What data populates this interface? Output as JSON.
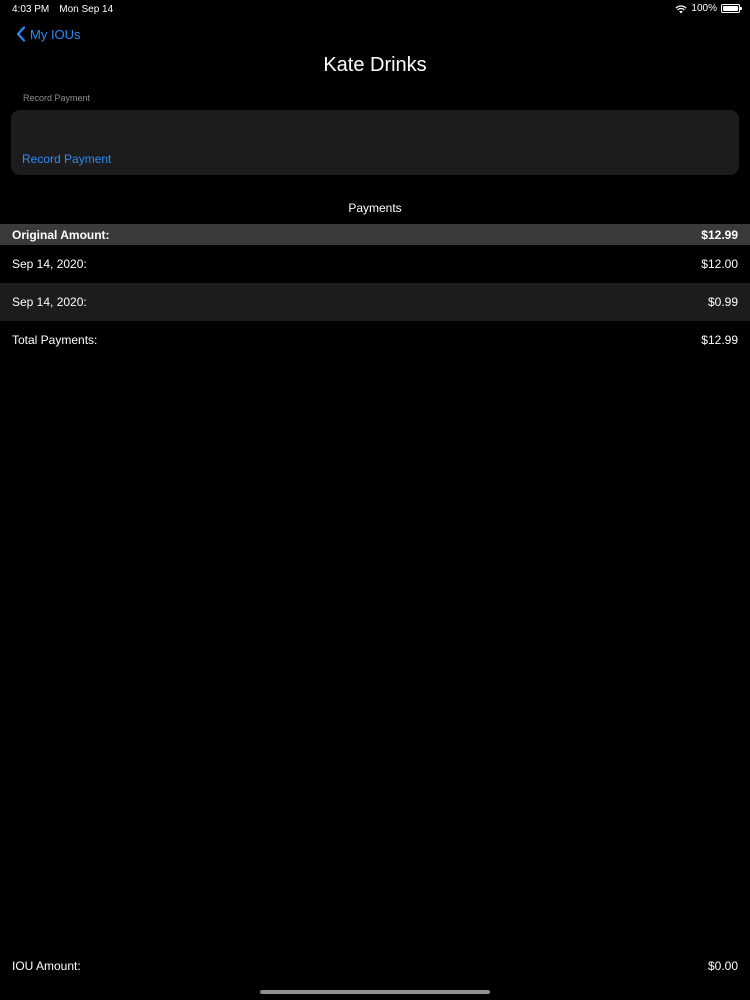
{
  "status_bar": {
    "time": "4:03 PM",
    "date": "Mon Sep 14",
    "battery": "100%",
    "battery_level": 1.0
  },
  "nav": {
    "back_label": "My IOUs",
    "title": "Kate Drinks"
  },
  "record_section": {
    "header": "Record Payment",
    "button_label": "Record Payment"
  },
  "payments": {
    "title": "Payments",
    "original": {
      "label": "Original Amount:",
      "value": "$12.99"
    },
    "items": [
      {
        "label": "Sep 14, 2020:",
        "value": "$12.00"
      },
      {
        "label": "Sep 14, 2020:",
        "value": "$0.99"
      }
    ],
    "total": {
      "label": "Total Payments:",
      "value": "$12.99"
    }
  },
  "footer": {
    "iou_label": "IOU Amount:",
    "iou_value": "$0.00"
  },
  "colors": {
    "accent": "#2b8cf4",
    "background": "#000000",
    "card": "#1c1c1e",
    "header_row": "#3a3a3c"
  }
}
